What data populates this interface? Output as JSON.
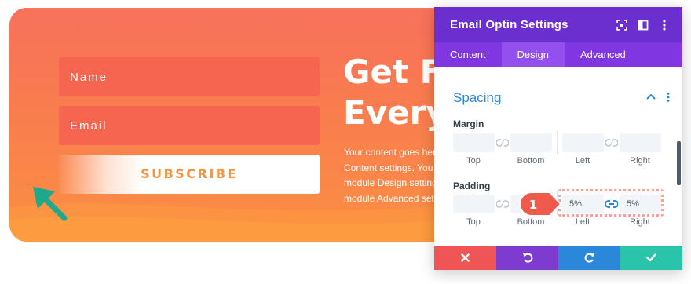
{
  "optin": {
    "name_placeholder": "Name",
    "email_placeholder": "Email",
    "subscribe_label": "SUBSCRIBE",
    "headline": "Get Fr\nEvery",
    "body": "Your content goes here\nContent settings. You c\nmodule Design setting\nmodule Advanced sett"
  },
  "panel": {
    "title": "Email Optin Settings",
    "header_icons": [
      "focus-icon",
      "sidebar-toggle-icon",
      "more-options-icon"
    ],
    "tabs": [
      {
        "label": "Content",
        "active": false
      },
      {
        "label": "Design",
        "active": true
      },
      {
        "label": "Advanced",
        "active": false
      }
    ],
    "section": {
      "title": "Spacing"
    },
    "margin": {
      "label": "Margin",
      "top": "",
      "bottom": "",
      "left": "",
      "right": "",
      "sublabels": [
        "Top",
        "Bottom",
        "Left",
        "Right"
      ]
    },
    "padding": {
      "label": "Padding",
      "top": "",
      "bottom": "",
      "left": "5%",
      "right": "5%",
      "sublabels": [
        "Top",
        "Bottom",
        "Left",
        "Right"
      ]
    },
    "step_badge": "1"
  },
  "footer": {
    "buttons": [
      "close-icon",
      "undo-icon",
      "redo-icon",
      "save-icon"
    ]
  },
  "colors": {
    "purple_header": "#6b2fcf",
    "purple_tabs": "#8036e0",
    "accent_blue": "#2b87da",
    "close_red": "#ef5555",
    "undo_purple": "#7e3bd0",
    "redo_blue": "#2b87da",
    "save_green": "#29c4a9",
    "optin_orange": "#f97d4e",
    "badge_red": "#ef5a4c",
    "arrow_teal": "#1ea88c"
  }
}
